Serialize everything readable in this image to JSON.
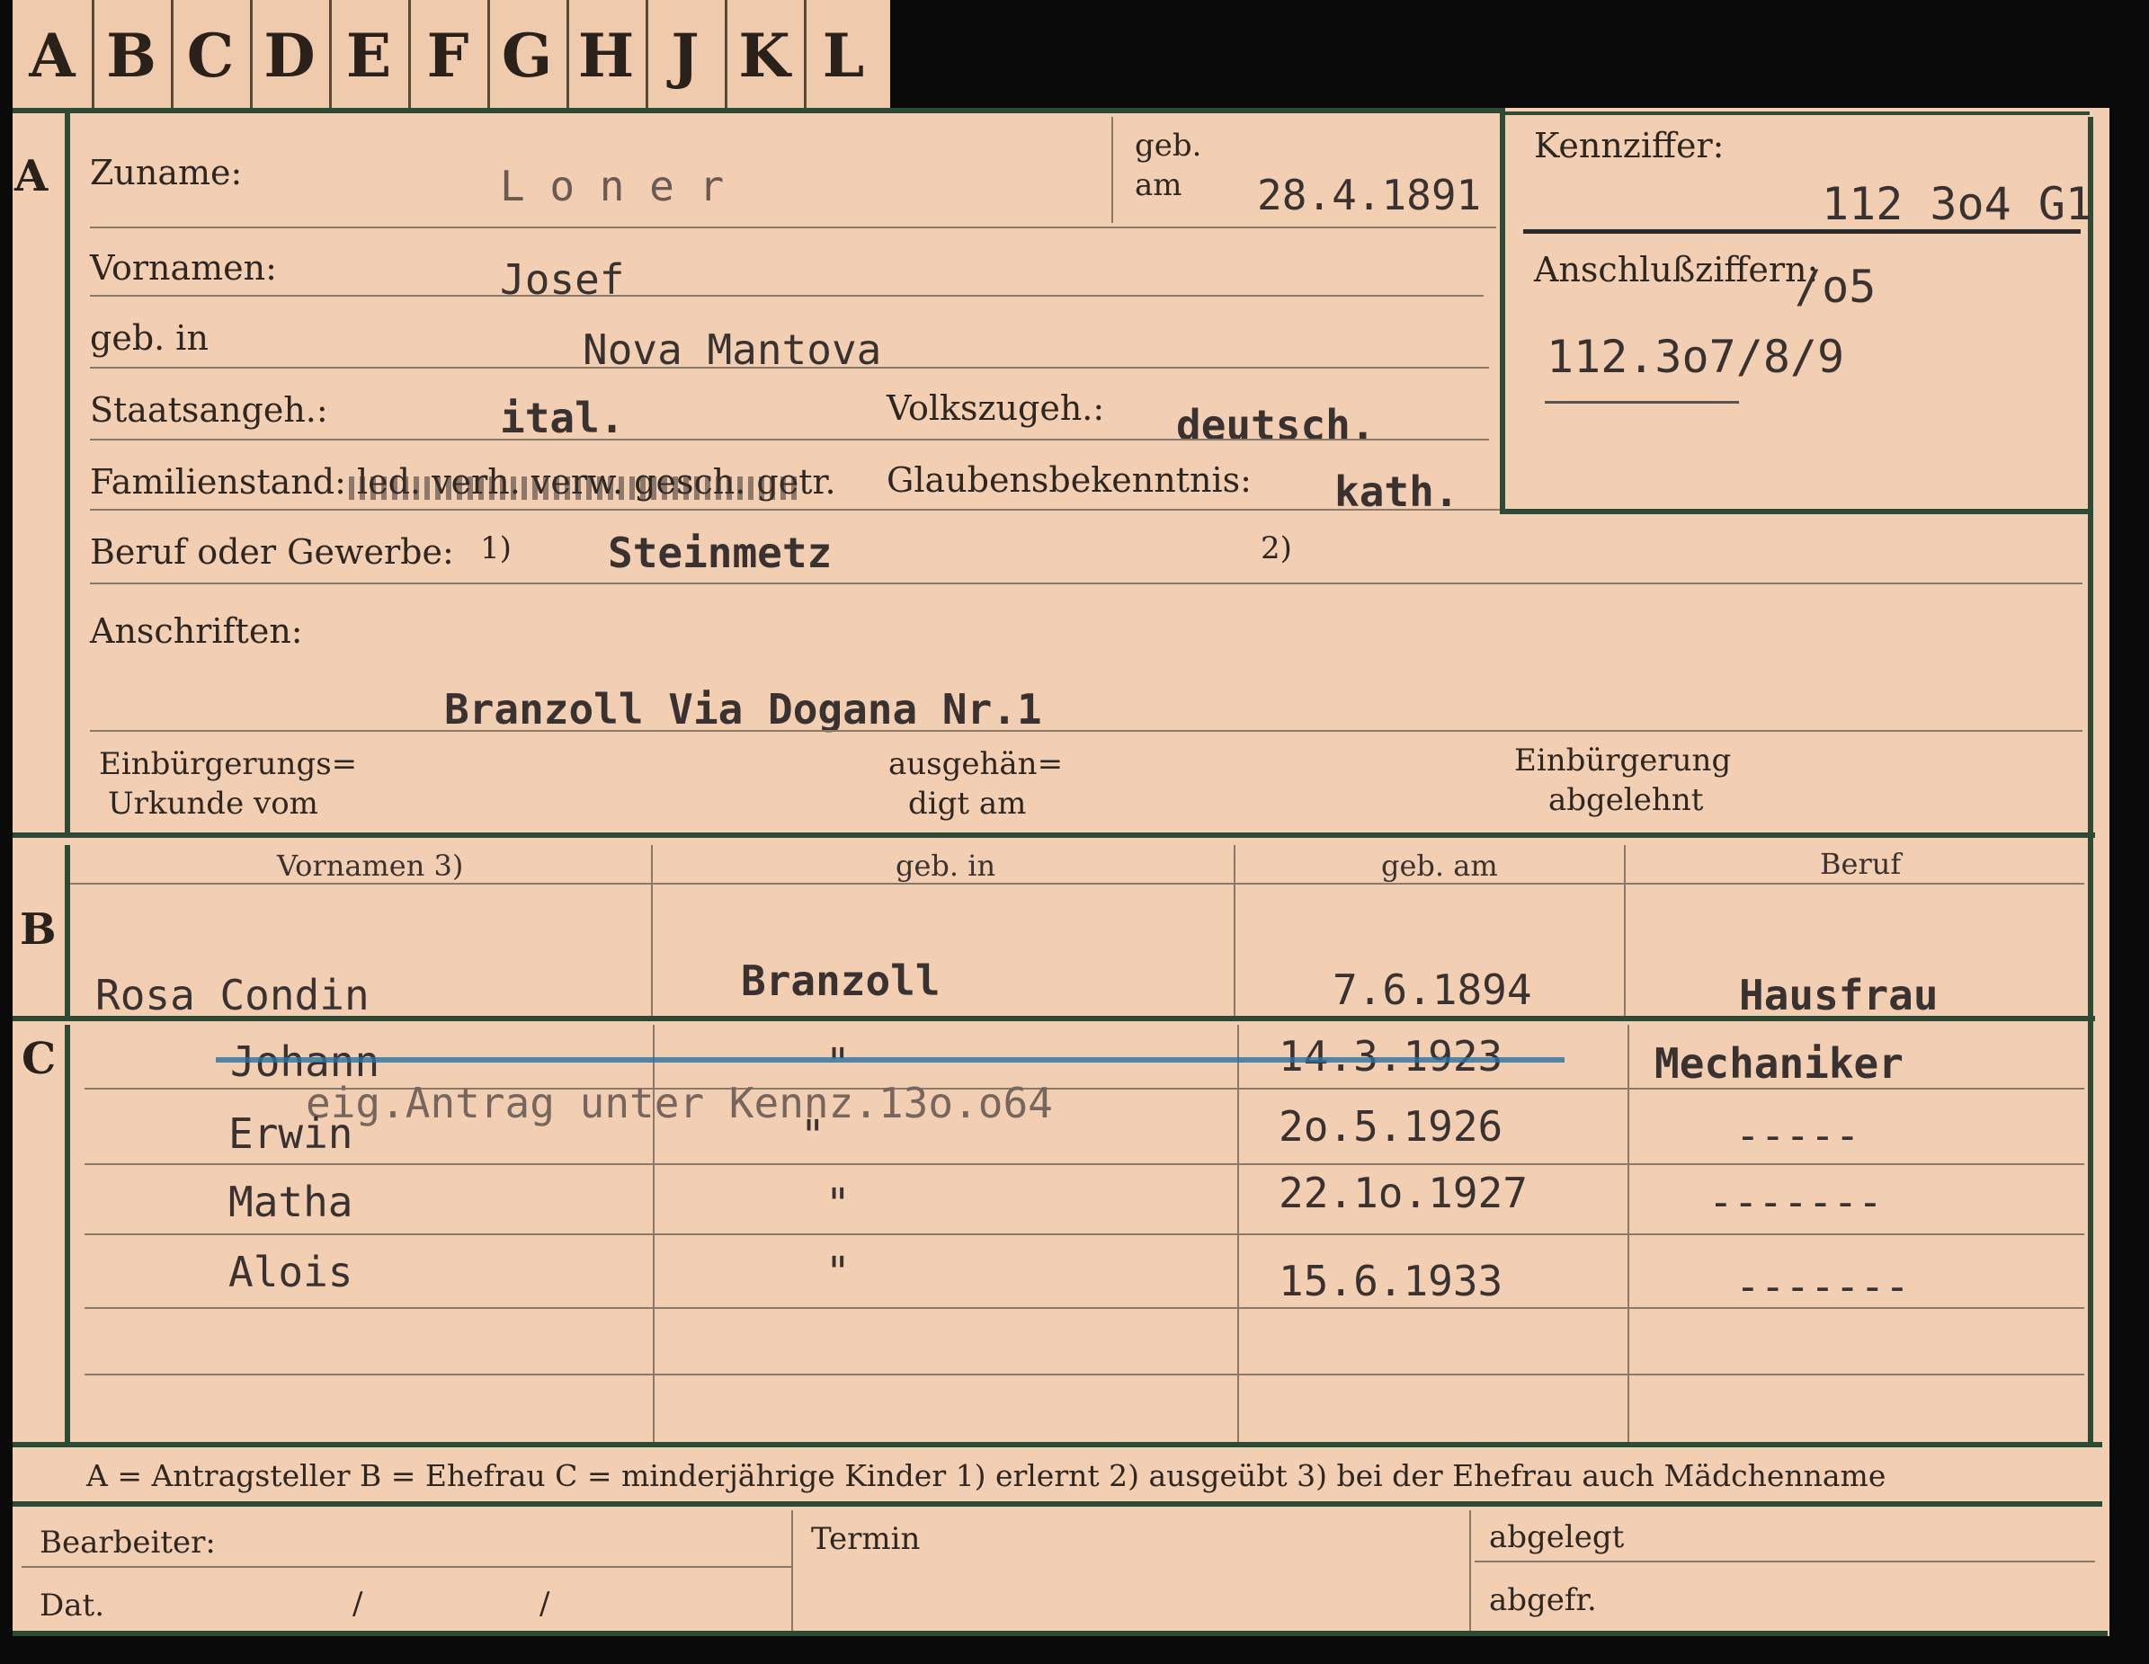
{
  "tabs": [
    "A",
    "B",
    "C",
    "D",
    "E",
    "F",
    "G",
    "H",
    "J",
    "K",
    "L"
  ],
  "sections": {
    "a": "A",
    "b": "B",
    "c": "C"
  },
  "person": {
    "surname_label": "Zuname:",
    "surname": "L o n e r",
    "born_on_label1": "geb.",
    "born_on_label2": "am",
    "born_on": "28.4.1891",
    "first_names_label": "Vornamen:",
    "first_names": "Josef",
    "born_in_label": "geb. in",
    "born_in": "Nova Mantova",
    "citizenship_label": "Staatsangeh.:",
    "citizenship": "ital.",
    "ethnicity_label": "Volkszugeh.:",
    "ethnicity": "deutsch.",
    "marital_label": "Familienstand: led. verh. verw. gesch. getr.",
    "religion_label": "Glaubensbekenntnis:",
    "religion": "kath.",
    "occupation_label": "Beruf oder Gewerbe:",
    "occupation_mark1": "1)",
    "occupation": "Steinmetz",
    "occupation_mark2": "2)",
    "addresses_label": "Anschriften:",
    "address": "Branzoll Via Dogana Nr.1",
    "naturalization_label1": "Einbürgerungs=",
    "naturalization_label2": "Urkunde vom",
    "handed_label1": "ausgehän=",
    "handed_label2": "digt am",
    "refused_label1": "Einbürgerung",
    "refused_label2": "abgelehnt"
  },
  "identifier": {
    "label": "Kennziffer:",
    "value": "112 3o4 G1",
    "linked_label": "Anschlußziffern:",
    "linked_suffix": "/o5",
    "linked_value": "112.3o7/8/9"
  },
  "spouse": {
    "headers": [
      "Vornamen 3)",
      "geb. in",
      "geb. am",
      "Beruf"
    ],
    "name": "Rosa Condin",
    "born_in": "Branzoll",
    "born_on": "7.6.1894",
    "occupation": "Hausfrau"
  },
  "children": [
    {
      "name": "Johann",
      "born_in": "\"",
      "born_on": "14.3.1923",
      "occupation": "Mechaniker",
      "struck": true
    },
    {
      "name": "Erwin",
      "born_in": "\"",
      "born_on": "2o.5.1926",
      "occupation": "-----",
      "struck": false
    },
    {
      "name": "Matha",
      "born_in": "\"",
      "born_on": "22.1o.1927",
      "occupation": "-------",
      "struck": false
    },
    {
      "name": "Alois",
      "born_in": "\"",
      "born_on": "15.6.1933",
      "occupation": "-------",
      "struck": false
    }
  ],
  "children_note": "eig.Antrag unter Kennz.13o.o64",
  "legend": "A = Antragsteller   B = Ehefrau   C = minderjährige Kinder   1) erlernt   2) ausgeübt   3) bei der Ehefrau auch Mädchenname",
  "footer": {
    "clerk_label": "Bearbeiter:",
    "date_label": "Dat.",
    "date_slash1": "/",
    "date_slash2": "/",
    "deadline_label": "Termin",
    "filed_label": "abgelegt",
    "filed_by_label": "abgefr."
  }
}
